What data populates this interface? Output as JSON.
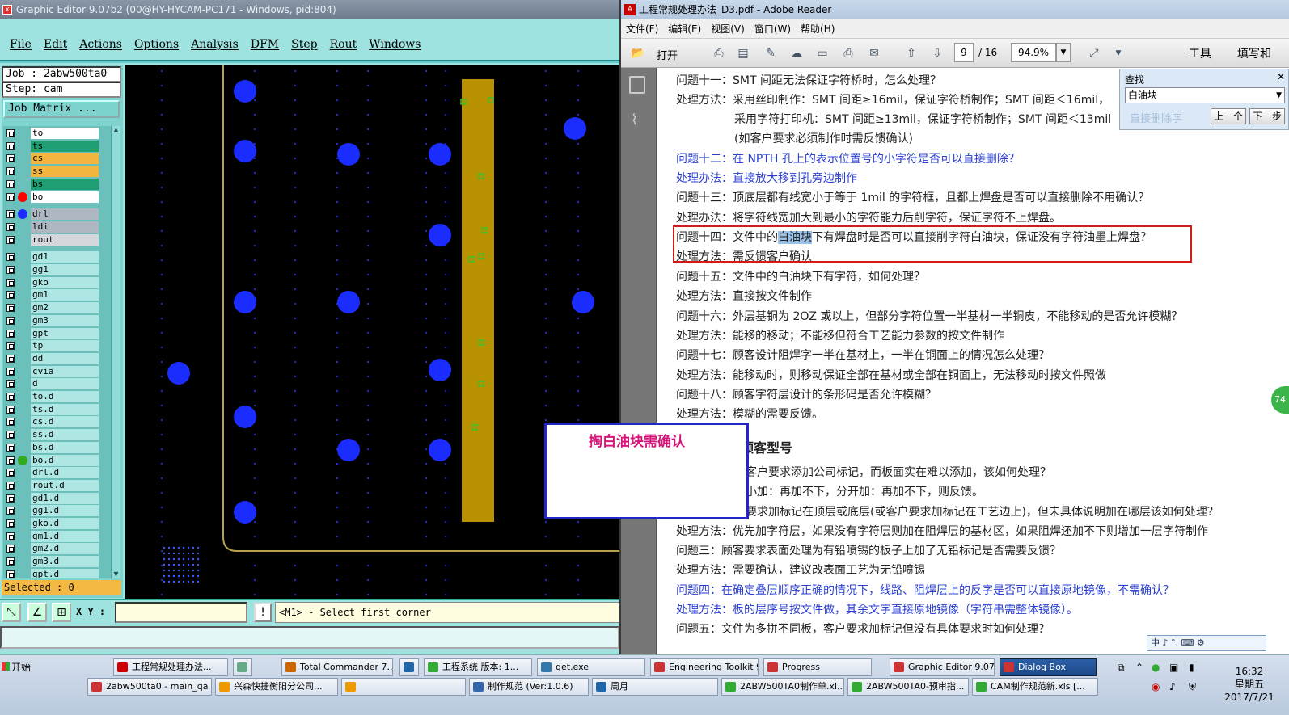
{
  "left_window": {
    "title": "Graphic Editor 9.07b2 (00@HY-HYCAM-PC171 - Windows, pid:804)",
    "menu": [
      "File",
      "Edit",
      "Actions",
      "Options",
      "Analysis",
      "DFM",
      "Step",
      "Rout",
      "Windows"
    ],
    "job_label": "Job : 2abw500ta0",
    "step_label": "Step: cam",
    "job_matrix_label": "Job Matrix ...",
    "layers": [
      {
        "name": "to",
        "color": "#ffffff",
        "dot": ""
      },
      {
        "name": "ts",
        "color": "#1f9e74",
        "dot": ""
      },
      {
        "name": "cs",
        "color": "#f2b640",
        "dot": ""
      },
      {
        "name": "ss",
        "color": "#f2b640",
        "dot": ""
      },
      {
        "name": "bs",
        "color": "#1f9e74",
        "dot": ""
      },
      {
        "name": "bo",
        "color": "#ffffff",
        "dot": "#ff0000"
      },
      {
        "name": "drl",
        "color": "#aeb8c2",
        "dot": "#1b2cff"
      },
      {
        "name": "ldi",
        "color": "#aeb8c2",
        "dot": ""
      },
      {
        "name": "rout",
        "color": "#d4d8dc",
        "dot": ""
      },
      {
        "name": "gd1",
        "color": "#aee6e3",
        "dot": ""
      },
      {
        "name": "gg1",
        "color": "#aee6e3",
        "dot": ""
      },
      {
        "name": "gko",
        "color": "#aee6e3",
        "dot": ""
      },
      {
        "name": "gm1",
        "color": "#aee6e3",
        "dot": ""
      },
      {
        "name": "gm2",
        "color": "#aee6e3",
        "dot": ""
      },
      {
        "name": "gm3",
        "color": "#aee6e3",
        "dot": ""
      },
      {
        "name": "gpt",
        "color": "#aee6e3",
        "dot": ""
      },
      {
        "name": "tp",
        "color": "#aee6e3",
        "dot": ""
      },
      {
        "name": "dd",
        "color": "#aee6e3",
        "dot": ""
      },
      {
        "name": "cvia",
        "color": "#aee6e3",
        "dot": ""
      },
      {
        "name": "d",
        "color": "#aee6e3",
        "dot": ""
      },
      {
        "name": "to.d",
        "color": "#aee6e3",
        "dot": ""
      },
      {
        "name": "ts.d",
        "color": "#aee6e3",
        "dot": ""
      },
      {
        "name": "cs.d",
        "color": "#aee6e3",
        "dot": ""
      },
      {
        "name": "ss.d",
        "color": "#aee6e3",
        "dot": ""
      },
      {
        "name": "bs.d",
        "color": "#aee6e3",
        "dot": ""
      },
      {
        "name": "bo.d",
        "color": "#aee6e3",
        "dot": "#33aa22"
      },
      {
        "name": "drl.d",
        "color": "#aee6e3",
        "dot": ""
      },
      {
        "name": "rout.d",
        "color": "#aee6e3",
        "dot": ""
      },
      {
        "name": "gd1.d",
        "color": "#aee6e3",
        "dot": ""
      },
      {
        "name": "gg1.d",
        "color": "#aee6e3",
        "dot": ""
      },
      {
        "name": "gko.d",
        "color": "#aee6e3",
        "dot": ""
      },
      {
        "name": "gm1.d",
        "color": "#aee6e3",
        "dot": ""
      },
      {
        "name": "gm2.d",
        "color": "#aee6e3",
        "dot": ""
      },
      {
        "name": "gm3.d",
        "color": "#aee6e3",
        "dot": ""
      },
      {
        "name": "gpt.d",
        "color": "#aee6e3",
        "dot": ""
      }
    ],
    "selected_label": "Selected : 0",
    "xy_label": "X Y :",
    "info_icon": "info-icon",
    "prompt_text": "<M1> - Select first corner"
  },
  "dialog": {
    "text": "掏白油块需确认"
  },
  "reader": {
    "title": "工程常规处理办法_D3.pdf - Adobe Reader",
    "menu": [
      "文件(F)",
      "编辑(E)",
      "视图(V)",
      "窗口(W)",
      "帮助(H)"
    ],
    "open_label": "打开",
    "page_current": "9",
    "page_total": "/ 16",
    "zoom": "94.9%",
    "tools_label": "工具",
    "fill_label": "填写和",
    "find": {
      "title": "查找",
      "value": "白油块",
      "ghost": "直接删除字",
      "prev": "上一个",
      "next": "下一步"
    },
    "lines": [
      {
        "t": "问题十一：SMT 间距无法保证字符桥时，怎么处理？",
        "c": "n"
      },
      {
        "t": "处理方法：采用丝印制作：SMT 间距≥16mil，保证字符桥制作；SMT 间距＜16mil，",
        "c": "n"
      },
      {
        "t": "采用字符打印机：SMT 间距≥13mil，保证字符桥制作；SMT 间距＜13mil",
        "c": "n"
      },
      {
        "t": "(如客户要求必须制作时需反馈确认)",
        "c": "n"
      },
      {
        "t": "问题十二：在 NPTH 孔上的表示位置号的小字符是否可以直接删除？",
        "c": "b"
      },
      {
        "t": "处理办法：直接放大移到孔旁边制作",
        "c": "b"
      },
      {
        "t": "问题十三：顶底层都有线宽小于等于 1mil 的字符框，且都上焊盘是否可以直接删除不用确认？",
        "c": "n"
      },
      {
        "t": "处理办法：将字符线宽加大到最小的字符能力后削字符，保证字符不上焊盘。",
        "c": "n"
      },
      {
        "t": "下有焊盘时是否可以直接削字符白油块，保证没有字符油墨上焊盘？",
        "c": "n"
      },
      {
        "t": "处理方法：需反馈客户确认",
        "c": "n"
      },
      {
        "t": "问题十五：文件中的白油块下有字符，如何处理？",
        "c": "n"
      },
      {
        "t": "处理方法：直接按文件制作",
        "c": "n"
      },
      {
        "t": "问题十六：外层基铜为 2OZ 或以上，但部分字符位置一半基材一半铜皮，不能移动的是否允许模糊？",
        "c": "n"
      },
      {
        "t": "处理方法：能移的移动；不能移但符合工艺能力参数的按文件制作",
        "c": "n"
      },
      {
        "t": "问题十七：顾客设计阻焊字一半在基材上，一半在铜面上的情况怎么处理？",
        "c": "n"
      },
      {
        "t": "处理方法：能移动时，则移动保证全部在基材或全部在铜面上，无法移动时按文件照做",
        "c": "n"
      },
      {
        "t": "问题十八：顾客字符层设计的条形码是否允许模糊？",
        "c": "n"
      },
      {
        "t": "处理方法：模糊的需要反馈。",
        "c": "n"
      },
      {
        "t": "顾客型号",
        "c": "h"
      },
      {
        "t": "客户要求添加公司标记，而板面实在难以添加，该如何处理？",
        "c": "n"
      },
      {
        "t": "小加：再加不下，分开加：再加不下，则反馈。",
        "c": "n"
      },
      {
        "t": "要求加标记在顶层或底层(或客户要求加标记在工艺边上)，但未具体说明加在哪层该如何处理？",
        "c": "n"
      },
      {
        "t": "处理方法：优先加字符层，如果没有字符层则加在阻焊层的基材区，如果阻焊还加不下则增加一层字符制作",
        "c": "n"
      },
      {
        "t": "问题三：顾客要求表面处理为有铅喷锡的板子上加了无铅标记是否需要反馈？",
        "c": "n"
      },
      {
        "t": "处理方法：需要确认，建议改表面工艺为无铅喷锡",
        "c": "n"
      },
      {
        "t": "问题四：在确定叠层顺序正确的情况下，线路、阻焊层上的反字是否可以直接原地镜像，不需确认？",
        "c": "b"
      },
      {
        "t": "处理方法：板的层序号按文件做，其余文字直接原地镜像（字符串需整体镜像）。",
        "c": "b"
      },
      {
        "t": "问题五：文件为多拼不同板，客户要求加标记但没有具体要求时如何处理？",
        "c": "n"
      }
    ],
    "line14_prefix": "问题十四：文件中的",
    "line14_highlight": "白油块",
    "ime_text": "中 ♪ °, ⌨ ⚙",
    "badge": "74"
  },
  "taskbar": {
    "start": "开始",
    "row1": [
      {
        "label": "工程常规处理办法...",
        "icon": "#c00"
      },
      {
        "label": "",
        "icon": "#6a8"
      },
      {
        "label": "Total Commander 7....",
        "icon": "#c60"
      },
      {
        "label": "",
        "icon": "#26a"
      },
      {
        "label": "工程系统  版本: 1...",
        "icon": "#3a3"
      },
      {
        "label": "get.exe",
        "icon": "#37a"
      },
      {
        "label": "Engineering Toolkit 9...",
        "icon": "#c33"
      },
      {
        "label": "Progress",
        "icon": "#c33"
      },
      {
        "label": "Graphic Editor 9.07b...",
        "icon": "#c33"
      },
      {
        "label": "Dialog Box",
        "icon": "#c33"
      }
    ],
    "row2": [
      {
        "label": "2abw500ta0 - main_qa",
        "icon": "#c33"
      },
      {
        "label": "兴森快捷衡阳分公司...",
        "icon": "#e90"
      },
      {
        "label": "",
        "icon": "#e90"
      },
      {
        "label": "制作规范 (Ver:1.0.6)",
        "icon": "#36a"
      },
      {
        "label": "周月",
        "icon": "#26a"
      },
      {
        "label": "2ABW500TA0制作单.xl...",
        "icon": "#3a3"
      },
      {
        "label": "2ABW500TA0-预审指...",
        "icon": "#3a3"
      },
      {
        "label": "CAM制作规范新.xls [...",
        "icon": "#3a3"
      }
    ],
    "time": "16:32",
    "weekday": "星期五",
    "date": "2017/7/21"
  }
}
